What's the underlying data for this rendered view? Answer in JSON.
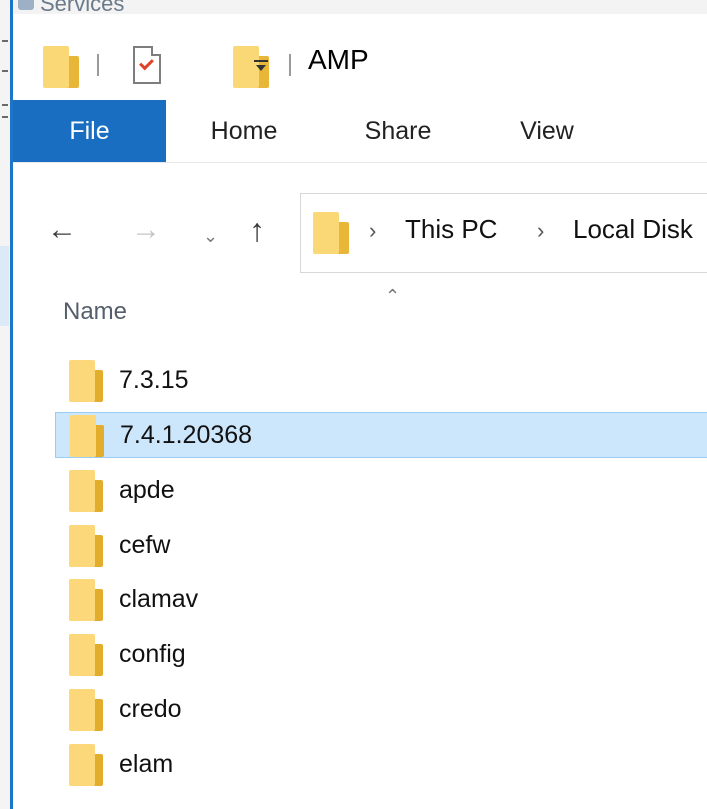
{
  "background_window": {
    "title": "Services"
  },
  "window": {
    "title": "AMP"
  },
  "ribbon": {
    "tabs": [
      {
        "label": "File"
      },
      {
        "label": "Home"
      },
      {
        "label": "Share"
      },
      {
        "label": "View"
      }
    ]
  },
  "address_bar": {
    "breadcrumb": [
      "This PC",
      "Local Disk"
    ]
  },
  "columns": {
    "name": "Name",
    "sort": "ascending"
  },
  "files": [
    {
      "name": "7.3.15",
      "type": "folder",
      "selected": false
    },
    {
      "name": "7.4.1.20368",
      "type": "folder",
      "selected": true
    },
    {
      "name": "apde",
      "type": "folder",
      "selected": false
    },
    {
      "name": "cefw",
      "type": "folder",
      "selected": false
    },
    {
      "name": "clamav",
      "type": "folder",
      "selected": false
    },
    {
      "name": "config",
      "type": "folder",
      "selected": false
    },
    {
      "name": "credo",
      "type": "folder",
      "selected": false
    },
    {
      "name": "elam",
      "type": "folder",
      "selected": false
    }
  ],
  "colors": {
    "file_tab": "#1a6ec2",
    "selection": "#cce6fb",
    "selection_border": "#99cdf6",
    "folder_front": "#fcd87a",
    "folder_back": "#e2ad2c"
  },
  "icons": {
    "quick_access": [
      "folder-icon",
      "properties-icon",
      "new-folder-icon",
      "customize-dropdown-icon"
    ],
    "navigation": [
      "back-arrow-icon",
      "forward-arrow-icon",
      "recent-locations-icon",
      "up-arrow-icon"
    ]
  }
}
